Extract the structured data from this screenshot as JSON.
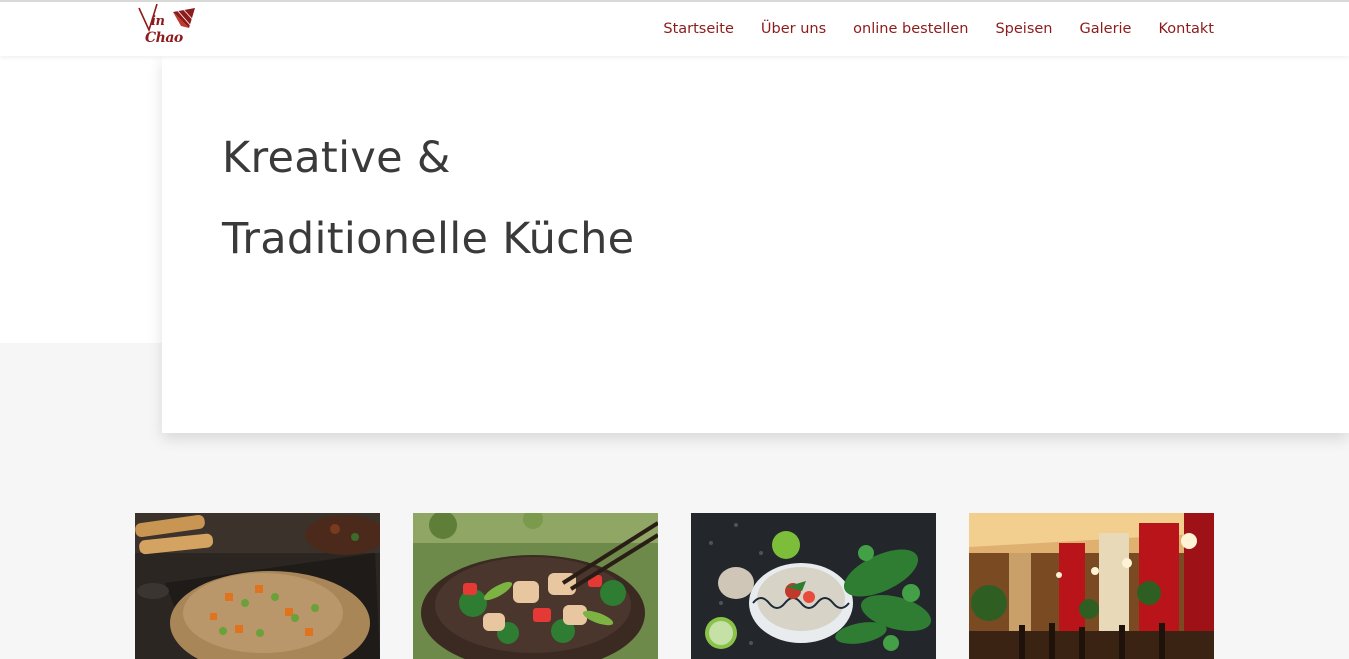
{
  "header": {
    "logo": {
      "line1": "in",
      "line2": "Chao"
    },
    "nav": [
      {
        "label": "Startseite"
      },
      {
        "label": "Über uns"
      },
      {
        "label": "online bestellen"
      },
      {
        "label": "Speisen"
      },
      {
        "label": "Galerie"
      },
      {
        "label": "Kontakt"
      }
    ]
  },
  "hero": {
    "line1": "Kreative &",
    "line2": "Traditionelle Küche"
  },
  "gallery": [
    {
      "image": "fried-rice-spring-rolls-image"
    },
    {
      "image": "chicken-vegetable-bowl-image"
    },
    {
      "image": "pho-soup-herbs-image"
    },
    {
      "image": "restaurant-interior-image"
    }
  ],
  "colors": {
    "brand": "#8e1b1b",
    "text": "#3a3a3a",
    "background": "#f6f6f6"
  }
}
